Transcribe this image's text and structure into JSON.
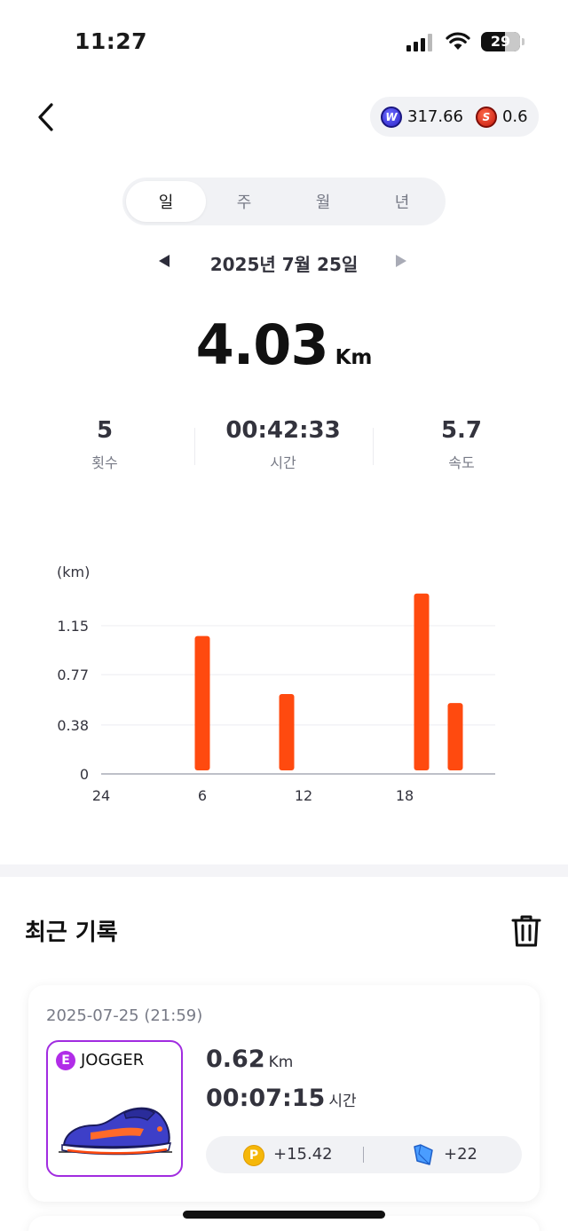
{
  "status_bar": {
    "time": "11:27",
    "battery": "29"
  },
  "balance": {
    "w_amount": "317.66",
    "s_amount": "0.6"
  },
  "period_tabs": [
    {
      "label": "일",
      "active": true
    },
    {
      "label": "주",
      "active": false
    },
    {
      "label": "월",
      "active": false
    },
    {
      "label": "년",
      "active": false
    }
  ],
  "date_label": "2025년 7월 25일",
  "summary": {
    "distance": "4.03",
    "distance_unit": "Km",
    "stats": [
      {
        "value": "5",
        "label": "횟수"
      },
      {
        "value": "00:42:33",
        "label": "시간"
      },
      {
        "value": "5.7",
        "label": "속도"
      }
    ]
  },
  "chart_data": {
    "type": "bar",
    "ylabel": "(km)",
    "ylim": [
      0,
      1.15
    ],
    "yticks": [
      "0",
      "0.38",
      "0.77",
      "1.15"
    ],
    "xticks": [
      "24",
      "6",
      "12",
      "18"
    ],
    "x_range": [
      0,
      24
    ],
    "grid": true,
    "bar_color": "#ff4a0f",
    "series": [
      {
        "values": [
          {
            "hour": 6,
            "km": 1.07
          },
          {
            "hour": 11,
            "km": 0.62
          },
          {
            "hour": 19,
            "km": 1.4
          },
          {
            "hour": 21,
            "km": 0.55
          }
        ]
      }
    ]
  },
  "recent": {
    "title": "최근 기록",
    "records": [
      {
        "datetime": "2025-07-25 (21:59)",
        "shoe_grade": "E",
        "shoe_type": "JOGGER",
        "distance": "0.62",
        "distance_unit": "Km",
        "duration": "00:07:15",
        "duration_unit": "시간",
        "points": "+15.42",
        "map_reward": "+22"
      }
    ]
  },
  "colors": {
    "accent": "#ff4a0f",
    "badge": "#b12ce8",
    "point": "#f5b70a"
  }
}
